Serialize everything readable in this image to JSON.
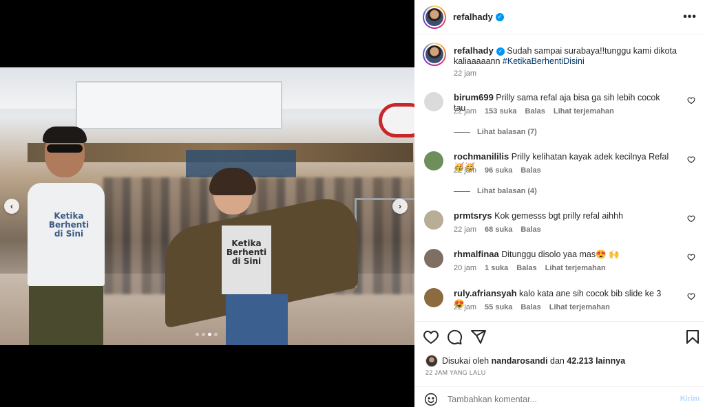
{
  "post": {
    "username": "refalhady",
    "verified": true,
    "caption": "Sudah sampai surabaya!!tunggu kami dikota kaliaaaaann",
    "hashtag": "#KetikaBerhentiDisini",
    "caption_time": "22 jam",
    "shirt_text_man": "Ketika Berhenti di Sini",
    "shirt_text_woman": "Ketika Berhenti di Sini",
    "carousel": {
      "slide_count": 4,
      "active_index": 2
    }
  },
  "comments": [
    {
      "username": "birum699",
      "text": "Prilly sama refal aja bisa ga sih lebih cocok tau",
      "time": "22 jam",
      "likes": "153 suka",
      "reply_label": "Balas",
      "translate_label": "Lihat terjemahan",
      "view_replies": "Lihat balasan (7)",
      "avatar_color": "#dbdbdb"
    },
    {
      "username": "rochmanililis",
      "text": "Prilly kelihatan kayak adek kecilnya Refal 🥳🥳",
      "time": "22 jam",
      "likes": "96 suka",
      "reply_label": "Balas",
      "translate_label": "",
      "view_replies": "Lihat balasan (4)",
      "avatar_color": "#6e8e5a"
    },
    {
      "username": "prmtsrys",
      "text": "Kok gemesss bgt prilly refal aihhh",
      "time": "22 jam",
      "likes": "68 suka",
      "reply_label": "Balas",
      "translate_label": "",
      "view_replies": "",
      "avatar_color": "#b9ad95"
    },
    {
      "username": "rhmalfinaa",
      "text": "Ditunggu disolo yaa mas😍 🙌",
      "time": "20 jam",
      "likes": "1 suka",
      "reply_label": "Balas",
      "translate_label": "Lihat terjemahan",
      "view_replies": "",
      "avatar_color": "#7f6f63"
    },
    {
      "username": "ruly.afriansyah",
      "text": "kalo kata ane sih cocok bib slide ke 3 😍",
      "time": "22 jam",
      "likes": "55 suka",
      "reply_label": "Balas",
      "translate_label": "Lihat terjemahan",
      "view_replies": "",
      "avatar_color": "#8b6b3f"
    }
  ],
  "likes": {
    "prefix": "Disukai oleh",
    "liker": "nandarosandi",
    "middle": "dan",
    "count": "42.213 lainnya"
  },
  "time_ago": "22 JAM YANG LALU",
  "add_comment": {
    "placeholder": "Tambahkan komentar...",
    "post_label": "Kirim"
  },
  "icons": {
    "more": "more-horizontal-icon",
    "like": "heart-icon",
    "comment": "comment-bubble-icon",
    "share": "paper-plane-icon",
    "save": "bookmark-icon",
    "emoji": "emoji-smile-icon",
    "prev": "chevron-left-icon",
    "next": "chevron-right-icon"
  },
  "colors": {
    "verified": "#0095f6",
    "hashtag": "#00376b",
    "muted": "#737373",
    "post_button": "#b3dbff"
  }
}
